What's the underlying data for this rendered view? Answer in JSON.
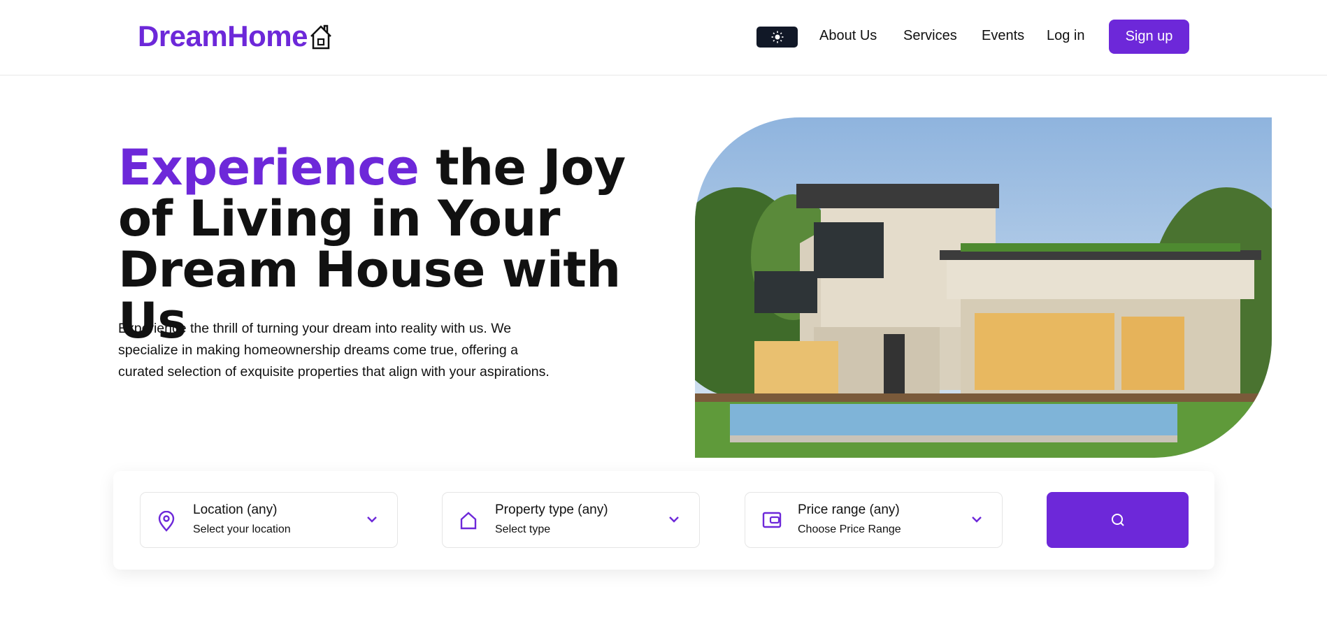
{
  "brand": {
    "name": "DreamHome",
    "accent": "#6d28d9"
  },
  "nav": {
    "theme_icon": "sun-icon",
    "items": [
      {
        "label": "About Us"
      },
      {
        "label": "Services"
      },
      {
        "label": "Events"
      },
      {
        "label": "Log in"
      }
    ],
    "signup": "Sign up"
  },
  "hero": {
    "title_accent": "Experience",
    "title_rest": " the Joy of Living in Your Dream House with Us",
    "text": "Experience the thrill of turning your dream into reality with us. We specialize in making homeownership dreams come true, offering a curated selection of exquisite properties that align with your aspirations."
  },
  "search": {
    "fields": [
      {
        "title": "Location (any)",
        "subtitle": "Select your location",
        "icon": "map-pin-icon"
      },
      {
        "title": "Property type (any)",
        "subtitle": "Select type",
        "icon": "home-icon"
      },
      {
        "title": "Price range (any)",
        "subtitle": "Choose Price Range",
        "icon": "wallet-icon"
      }
    ],
    "button_icon": "search-icon"
  }
}
